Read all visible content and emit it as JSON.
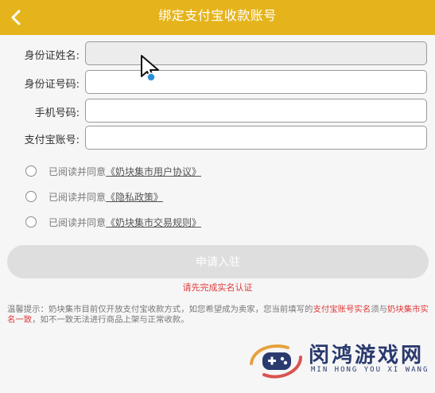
{
  "header": {
    "title": "绑定支付宝收款账号",
    "back_icon": "chevron-left-icon",
    "color": "#e5b41c"
  },
  "form": {
    "fields": [
      {
        "label": "身份证姓名:",
        "value": ""
      },
      {
        "label": "身份证号码:",
        "value": ""
      },
      {
        "label": "手机号码:",
        "value": ""
      },
      {
        "label": "支付宝账号:",
        "value": ""
      }
    ]
  },
  "agreements": [
    {
      "prefix": "已阅读并同意",
      "link": "《奶块集市用户协议》"
    },
    {
      "prefix": "已阅读并同意",
      "link": "《隐私政策》"
    },
    {
      "prefix": "已阅读并同意",
      "link": "《奶块集市交易规则》"
    }
  ],
  "submit": {
    "label": "申请入驻"
  },
  "warning": {
    "text": "请先完成实名认证",
    "color": "#e03a3a"
  },
  "tips": {
    "part1": "温馨提示：奶块集市目前仅开放支付宝收款方式，如您希望成为卖家，您当前填写的",
    "red1": "支付宝账号实名",
    "part2": "须与",
    "red2": "奶块集市实名一致",
    "part3": "，如不一致无法进行商品上架与正常收款。"
  },
  "watermark": {
    "name_cn": "闵鸿游戏网",
    "name_en": "MIN HONG YOU XI WANG"
  }
}
